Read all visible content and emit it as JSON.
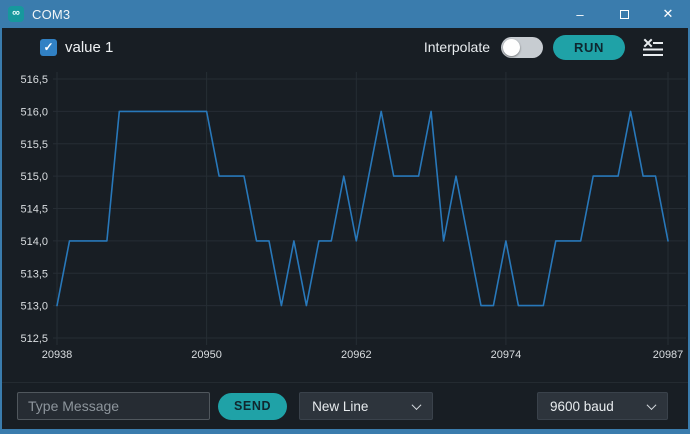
{
  "window": {
    "title": "COM3",
    "app_icon_glyph": "∞",
    "minimize_glyph": "–",
    "close_glyph": "✕"
  },
  "toolbar": {
    "series_checkbox": {
      "label": "value 1",
      "checked": true,
      "check_glyph": "✓"
    },
    "interpolate_label": "Interpolate",
    "interpolate_enabled": false,
    "run_label": "RUN"
  },
  "chart_data": {
    "type": "line",
    "title": "",
    "xlabel": "",
    "ylabel": "",
    "xlim": [
      20938,
      20987
    ],
    "ylim": [
      512.5,
      516.5
    ],
    "grid": true,
    "x_start": 20938,
    "x_increment": 1,
    "x_ticks": [
      {
        "label": "20938",
        "index": 0
      },
      {
        "label": "20950",
        "index": 12
      },
      {
        "label": "20962",
        "index": 24
      },
      {
        "label": "20974",
        "index": 36
      },
      {
        "label": "20987",
        "index": 49
      }
    ],
    "y_tick_values": [
      516.5,
      516.0,
      515.5,
      515.0,
      514.5,
      514.0,
      513.5,
      513.0,
      512.5
    ],
    "y_tick_labels": [
      "516,5",
      "516,0",
      "515,5",
      "515,0",
      "514,5",
      "514,0",
      "513,5",
      "513,0",
      "512,5"
    ],
    "series": [
      {
        "name": "value 1",
        "color": "#2878ba",
        "values": [
          513,
          514,
          514,
          514,
          514,
          516,
          516,
          516,
          516,
          516,
          516,
          516,
          516,
          515,
          515,
          515,
          514,
          514,
          513,
          514,
          513,
          514,
          514,
          515,
          514,
          515,
          516,
          515,
          515,
          515,
          516,
          514,
          515,
          514,
          513,
          513,
          514,
          513,
          513,
          513,
          514,
          514,
          514,
          515,
          515,
          515,
          516,
          515,
          515,
          514
        ]
      }
    ]
  },
  "message_bar": {
    "placeholder": "Type Message",
    "send_label": "SEND",
    "line_ending_selected": "New Line",
    "baud_selected": "9600 baud"
  },
  "colors": {
    "titlebar": "#3a7cad",
    "accent_teal": "#1fa2a7",
    "background": "#181e24",
    "grid": "#262d34",
    "line": "#2878ba",
    "checkbox": "#3181c4"
  }
}
